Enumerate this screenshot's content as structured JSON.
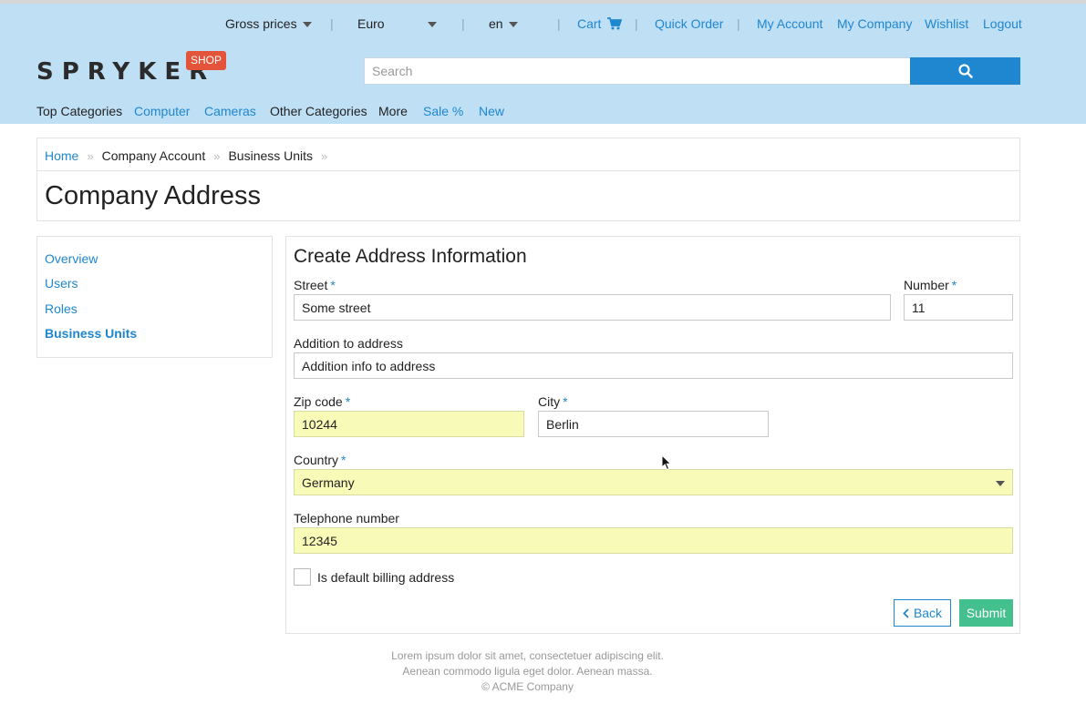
{
  "topbar": {
    "price_mode": "Gross prices",
    "currency": "Euro",
    "language": "en",
    "separator": "|",
    "cart": "Cart",
    "quick_order": "Quick Order",
    "my_account": "My Account",
    "my_company": "My Company",
    "wishlist": "Wishlist",
    "logout": "Logout"
  },
  "logo": {
    "text": "SPRYKER",
    "badge": "SHOP"
  },
  "search": {
    "placeholder": "Search",
    "value": ""
  },
  "nav": {
    "items": [
      "Top Categories",
      "Computer",
      "Cameras",
      "Other Categories",
      "More",
      "Sale %",
      "New"
    ]
  },
  "breadcrumb": {
    "items": [
      "Home",
      "Company Account",
      "Business Units"
    ],
    "separator": "»"
  },
  "page": {
    "title": "Company Address"
  },
  "sidebar": {
    "items": [
      "Overview",
      "Users",
      "Roles",
      "Business Units"
    ],
    "active": "Business Units"
  },
  "form": {
    "title": "Create Address Information",
    "required_mark": "*",
    "street": {
      "label": "Street",
      "value": "Some street"
    },
    "number": {
      "label": "Number",
      "value": "11"
    },
    "addition": {
      "label": "Addition to address",
      "value": "Addition info to address"
    },
    "zip": {
      "label": "Zip code",
      "value": "10244"
    },
    "city": {
      "label": "City",
      "value": "Berlin"
    },
    "country": {
      "label": "Country",
      "value": "Germany"
    },
    "phone": {
      "label": "Telephone number",
      "value": "12345"
    },
    "default_billing": {
      "label": "Is default billing address",
      "checked": false
    },
    "back_label": "Back",
    "submit_label": "Submit"
  },
  "footer": {
    "line1": "Lorem ipsum dolor sit amet, consectetuer adipiscing elit.",
    "line2": "Aenean commodo ligula eget dolor. Aenean massa.",
    "line3": "© ACME Company"
  },
  "colors": {
    "header_bg": "#bfdff5",
    "link": "#1e87d0",
    "autofill_bg": "#f8fbb7",
    "submit_bg": "#43c08e",
    "badge_bg": "#e4543a"
  }
}
